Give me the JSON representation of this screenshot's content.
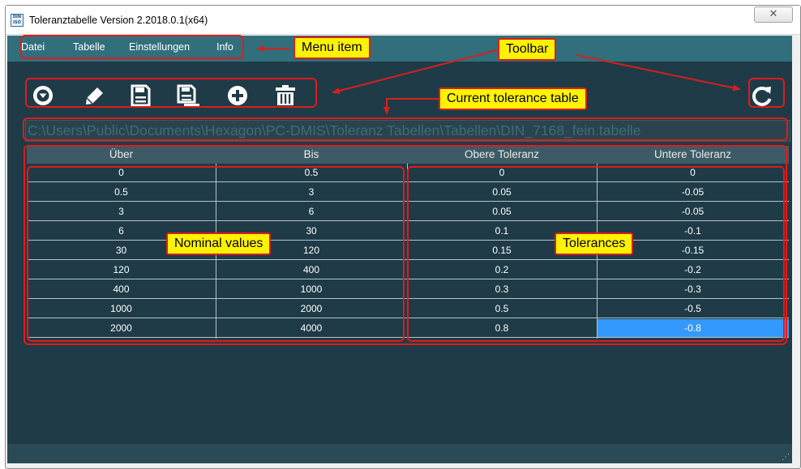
{
  "window": {
    "title": "Toleranztabelle  Version 2.2018.0.1(x64)",
    "icon_text": "DIN ISO",
    "close_glyph": "✕"
  },
  "menu": {
    "items": [
      "Datei",
      "Tabelle",
      "Einstellungen",
      "Info"
    ]
  },
  "toolbar": {
    "buttons": [
      {
        "icon": "dropdown-circle-icon"
      },
      {
        "icon": "pencil-icon"
      },
      {
        "icon": "save-icon"
      },
      {
        "icon": "save-as-icon"
      },
      {
        "icon": "add-circle-icon"
      },
      {
        "icon": "trash-icon"
      }
    ],
    "refresh_icon": "refresh-icon"
  },
  "current_path": "C:\\Users\\Public\\Documents\\Hexagon\\PC-DMIS\\Toleranz Tabellen\\Tabellen\\DIN_7168_fein.tabelle",
  "table": {
    "columns": [
      "Über",
      "Bis",
      "Obere Toleranz",
      "Untere Toleranz"
    ],
    "rows": [
      [
        "0",
        "0.5",
        "0",
        "0"
      ],
      [
        "0.5",
        "3",
        "0.05",
        "-0.05"
      ],
      [
        "3",
        "6",
        "0.05",
        "-0.05"
      ],
      [
        "6",
        "30",
        "0.1",
        "-0.1"
      ],
      [
        "30",
        "120",
        "0.15",
        "-0.15"
      ],
      [
        "120",
        "400",
        "0.2",
        "-0.2"
      ],
      [
        "400",
        "1000",
        "0.3",
        "-0.3"
      ],
      [
        "1000",
        "2000",
        "0.5",
        "-0.5"
      ],
      [
        "2000",
        "4000",
        "0.8",
        "-0.8"
      ]
    ],
    "selected_cell": "-0.8"
  },
  "annotations": {
    "menu_item": "Menu item",
    "toolbar": "Toolbar",
    "current_table": "Current tolerance table",
    "nominal_values": "Nominal values",
    "tolerances": "Tolerances"
  },
  "colors": {
    "client_bg": "#1f3b47",
    "menubar_bg": "#316f7c",
    "selection": "#3399ff",
    "annotation_border": "#e11b1b",
    "callout_fill": "#fff200"
  }
}
